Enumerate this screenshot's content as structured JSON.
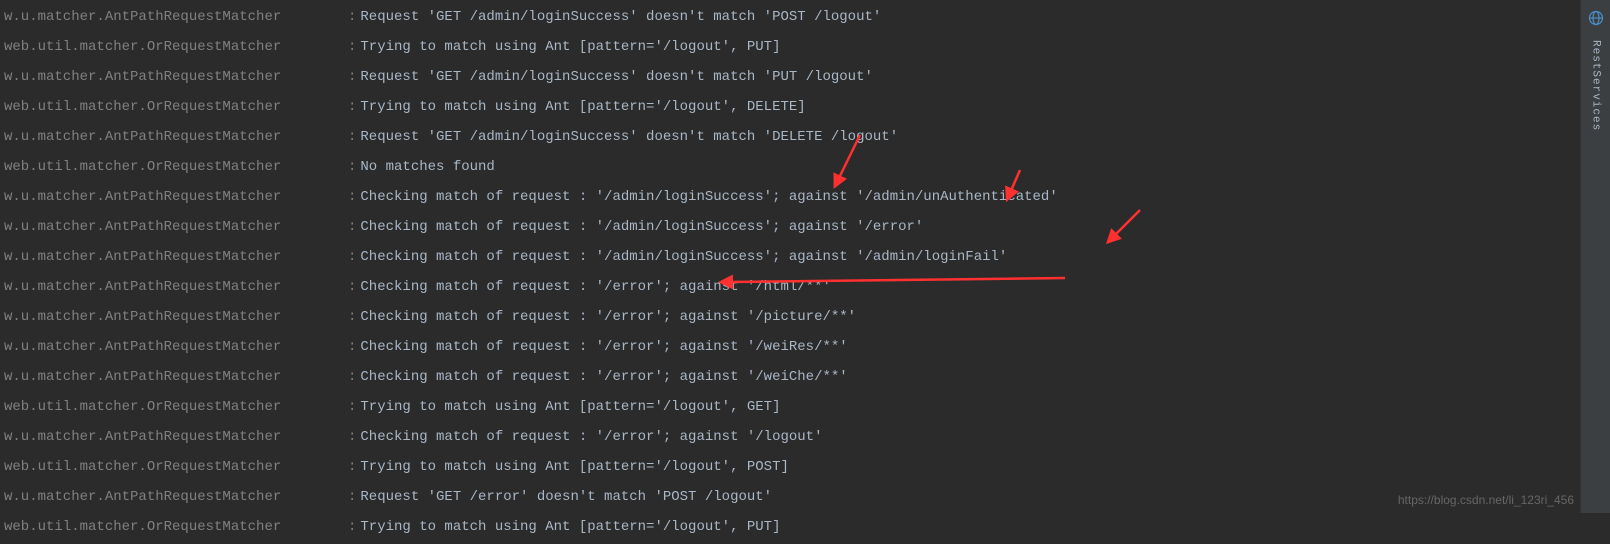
{
  "logs": [
    {
      "logger": "w.u.matcher.AntPathRequestMatcher",
      "message": "Request 'GET /admin/loginSuccess' doesn't match 'POST /logout'"
    },
    {
      "logger": "web.util.matcher.OrRequestMatcher",
      "message": "Trying to match using Ant [pattern='/logout', PUT]"
    },
    {
      "logger": "w.u.matcher.AntPathRequestMatcher",
      "message": "Request 'GET /admin/loginSuccess' doesn't match 'PUT /logout'"
    },
    {
      "logger": "web.util.matcher.OrRequestMatcher",
      "message": "Trying to match using Ant [pattern='/logout', DELETE]"
    },
    {
      "logger": "w.u.matcher.AntPathRequestMatcher",
      "message": "Request 'GET /admin/loginSuccess' doesn't match 'DELETE /logout'"
    },
    {
      "logger": "web.util.matcher.OrRequestMatcher",
      "message": "No matches found"
    },
    {
      "logger": "w.u.matcher.AntPathRequestMatcher",
      "message": "Checking match of request : '/admin/loginSuccess'; against '/admin/unAuthenticated'"
    },
    {
      "logger": "w.u.matcher.AntPathRequestMatcher",
      "message": "Checking match of request : '/admin/loginSuccess'; against '/error'"
    },
    {
      "logger": "w.u.matcher.AntPathRequestMatcher",
      "message": "Checking match of request : '/admin/loginSuccess'; against '/admin/loginFail'"
    },
    {
      "logger": "w.u.matcher.AntPathRequestMatcher",
      "message": "Checking match of request : '/error'; against '/html/**'"
    },
    {
      "logger": "w.u.matcher.AntPathRequestMatcher",
      "message": "Checking match of request : '/error'; against '/picture/**'"
    },
    {
      "logger": "w.u.matcher.AntPathRequestMatcher",
      "message": "Checking match of request : '/error'; against '/weiRes/**'"
    },
    {
      "logger": "w.u.matcher.AntPathRequestMatcher",
      "message": "Checking match of request : '/error'; against '/weiChe/**'"
    },
    {
      "logger": "web.util.matcher.OrRequestMatcher",
      "message": "Trying to match using Ant [pattern='/logout', GET]"
    },
    {
      "logger": "w.u.matcher.AntPathRequestMatcher",
      "message": "Checking match of request : '/error'; against '/logout'"
    },
    {
      "logger": "web.util.matcher.OrRequestMatcher",
      "message": "Trying to match using Ant [pattern='/logout', POST]"
    },
    {
      "logger": "w.u.matcher.AntPathRequestMatcher",
      "message": "Request 'GET /error' doesn't match 'POST /logout'"
    },
    {
      "logger": "web.util.matcher.OrRequestMatcher",
      "message": "Trying to match using Ant [pattern='/logout', PUT]"
    }
  ],
  "sidebar": {
    "label": "RestServices"
  },
  "watermark": "https://blog.csdn.net/li_123ri_456",
  "arrow_color": "#ff3030"
}
